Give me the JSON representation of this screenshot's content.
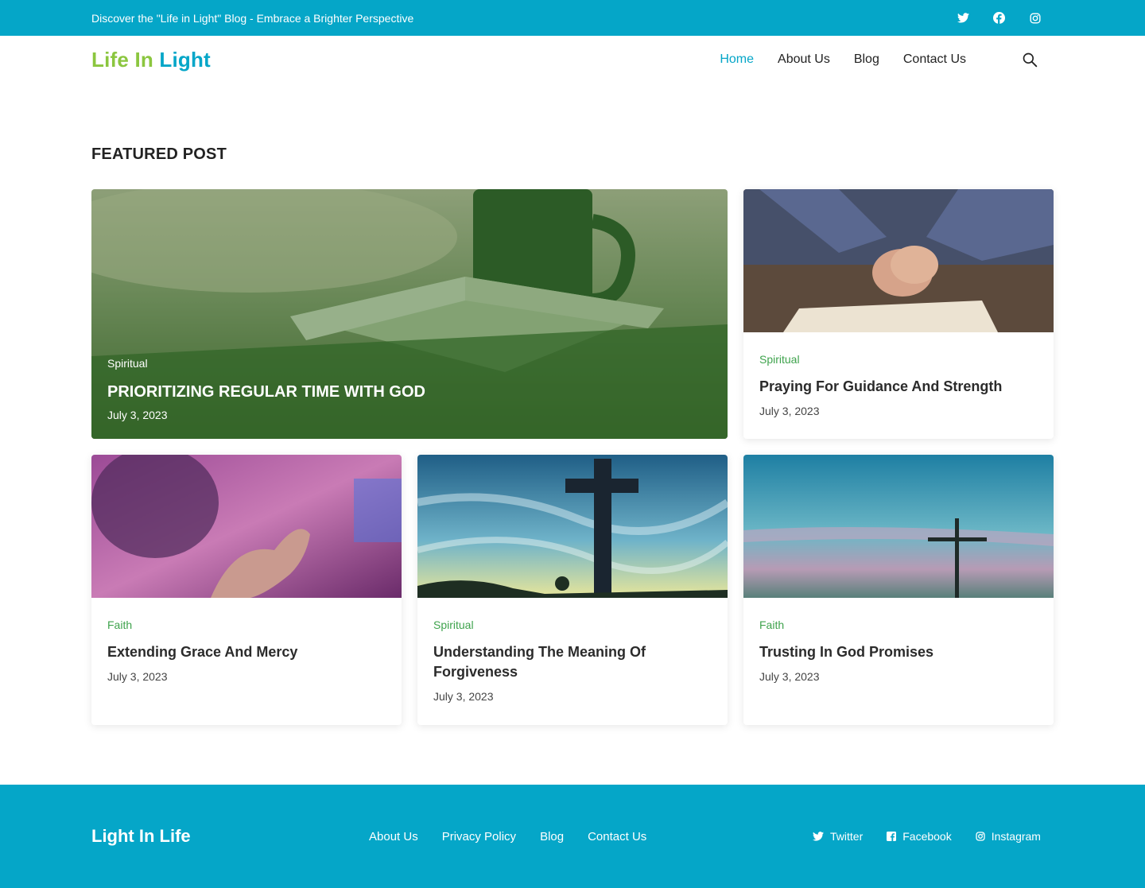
{
  "topbar": {
    "tagline": "Discover the \"Life in Light\" Blog - Embrace a Brighter Perspective",
    "social": [
      "twitter-icon",
      "facebook-icon",
      "instagram-icon"
    ]
  },
  "header": {
    "logo_part1": "Life In",
    "logo_part2": "Light",
    "nav": {
      "home": "Home",
      "about": "About Us",
      "blog": "Blog",
      "contact": "Contact Us"
    }
  },
  "colors": {
    "brand": "#05a6c8",
    "logo_green": "#8bc63f",
    "category_green": "#3fa34d"
  },
  "featured": {
    "section_title": "FEATURED POST",
    "main": {
      "category": "Spiritual",
      "title": "Prioritizing Regular Time With God",
      "date": "July 3, 2023"
    },
    "posts": [
      {
        "category": "Spiritual",
        "title": "Praying For Guidance And Strength",
        "date": "July 3, 2023"
      },
      {
        "category": "Faith",
        "title": "Extending Grace And Mercy",
        "date": "July 3, 2023"
      },
      {
        "category": "Spiritual",
        "title": "Understanding The Meaning Of Forgiveness",
        "date": "July 3, 2023"
      },
      {
        "category": "Faith",
        "title": "Trusting In God Promises",
        "date": "July 3, 2023"
      }
    ]
  },
  "footer": {
    "logo": "Light In Life",
    "links": {
      "about": "About Us",
      "privacy": "Privacy Policy",
      "blog": "Blog",
      "contact": "Contact Us"
    },
    "social": {
      "twitter": "Twitter",
      "facebook": "Facebook",
      "instagram": "Instagram"
    }
  }
}
